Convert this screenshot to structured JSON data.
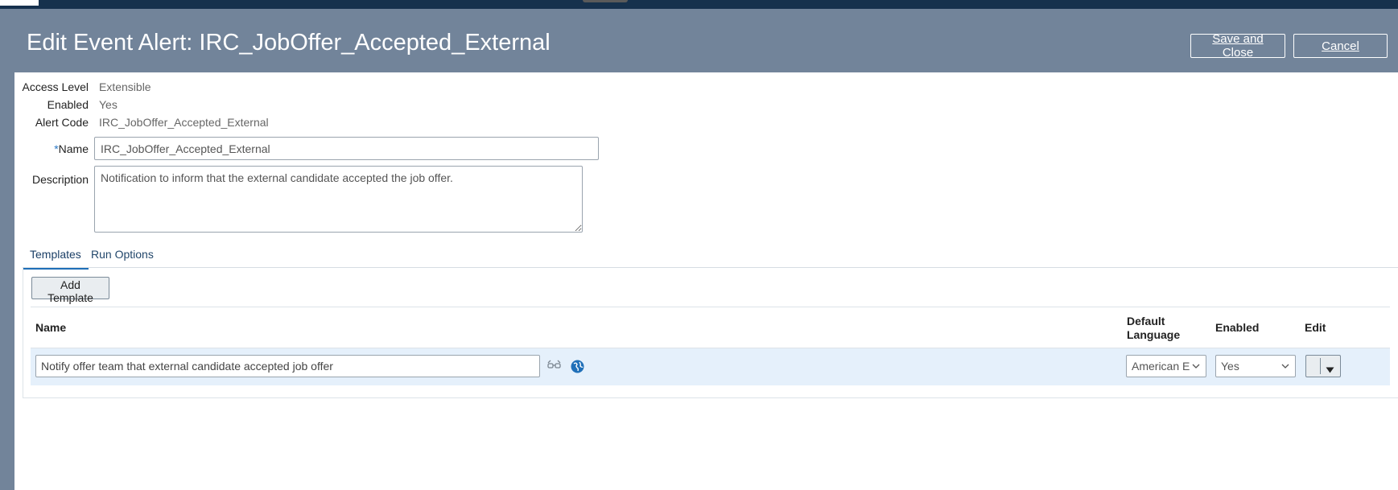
{
  "header": {
    "title": "Edit Event Alert: IRC_JobOffer_Accepted_External",
    "save_close_label": "Save and Close",
    "cancel_label": "Cancel"
  },
  "details": {
    "access_level": {
      "label": "Access Level",
      "value": "Extensible"
    },
    "enabled": {
      "label": "Enabled",
      "value": "Yes"
    },
    "alert_code": {
      "label": "Alert Code",
      "value": "IRC_JobOffer_Accepted_External"
    },
    "name": {
      "required_marker": "*",
      "label": "Name",
      "value": "IRC_JobOffer_Accepted_External"
    },
    "description": {
      "label": "Description",
      "value": "Notification to inform that the external candidate accepted the job offer."
    }
  },
  "tabs": [
    {
      "label": "Templates",
      "active": true
    },
    {
      "label": "Run Options",
      "active": false
    }
  ],
  "templates": {
    "add_label": "Add Template",
    "columns": {
      "name": "Name",
      "default_language_1": "Default",
      "default_language_2": "Language",
      "enabled": "Enabled",
      "edit": "Edit"
    },
    "rows": [
      {
        "name": "Notify offer team that external candidate accepted job offer",
        "default_language": "American E",
        "enabled": "Yes"
      }
    ]
  },
  "icons": {
    "preview": "glasses-icon",
    "translate": "globe-icon",
    "dropdown": "chevron-down-icon",
    "edit_menu": "caret-down-icon"
  },
  "colors": {
    "header_bg": "#72849a",
    "topbar_bg": "#16314d",
    "row_highlight": "#e5f0fb",
    "tab_accent": "#1f6fb8",
    "globe": "#1f6fb8"
  }
}
